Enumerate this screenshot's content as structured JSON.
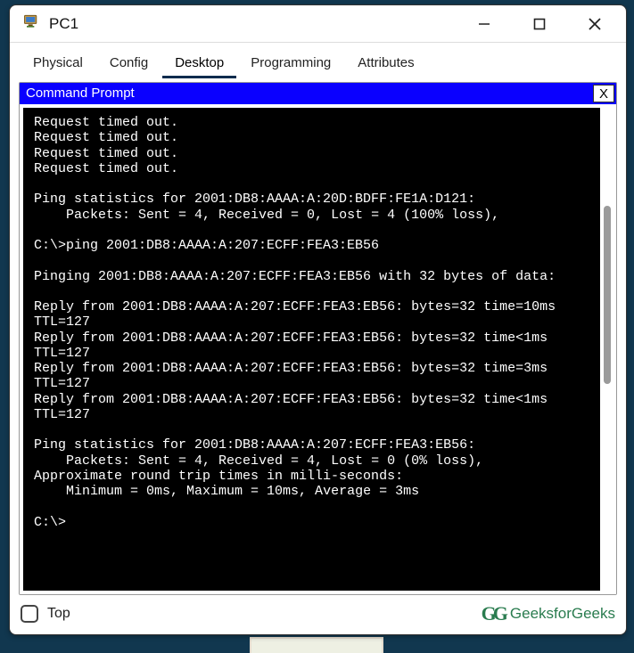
{
  "window": {
    "title": "PC1"
  },
  "tabs": [
    {
      "label": "Physical",
      "active": false
    },
    {
      "label": "Config",
      "active": false
    },
    {
      "label": "Desktop",
      "active": true
    },
    {
      "label": "Programming",
      "active": false
    },
    {
      "label": "Attributes",
      "active": false
    }
  ],
  "panel": {
    "title": "Command Prompt",
    "close": "X"
  },
  "terminal_lines": [
    "Request timed out.",
    "Request timed out.",
    "Request timed out.",
    "Request timed out.",
    "",
    "Ping statistics for 2001:DB8:AAAA:A:20D:BDFF:FE1A:D121:",
    "    Packets: Sent = 4, Received = 0, Lost = 4 (100% loss),",
    "",
    "C:\\>ping 2001:DB8:AAAA:A:207:ECFF:FEA3:EB56",
    "",
    "Pinging 2001:DB8:AAAA:A:207:ECFF:FEA3:EB56 with 32 bytes of data:",
    "",
    "Reply from 2001:DB8:AAAA:A:207:ECFF:FEA3:EB56: bytes=32 time=10ms TTL=127",
    "Reply from 2001:DB8:AAAA:A:207:ECFF:FEA3:EB56: bytes=32 time<1ms TTL=127",
    "Reply from 2001:DB8:AAAA:A:207:ECFF:FEA3:EB56: bytes=32 time=3ms TTL=127",
    "Reply from 2001:DB8:AAAA:A:207:ECFF:FEA3:EB56: bytes=32 time<1ms TTL=127",
    "",
    "Ping statistics for 2001:DB8:AAAA:A:207:ECFF:FEA3:EB56:",
    "    Packets: Sent = 4, Received = 4, Lost = 0 (0% loss),",
    "Approximate round trip times in milli-seconds:",
    "    Minimum = 0ms, Maximum = 10ms, Average = 3ms",
    "",
    "C:\\>"
  ],
  "footer": {
    "checkbox_label": "Top",
    "watermark": "GeeksforGeeks"
  }
}
